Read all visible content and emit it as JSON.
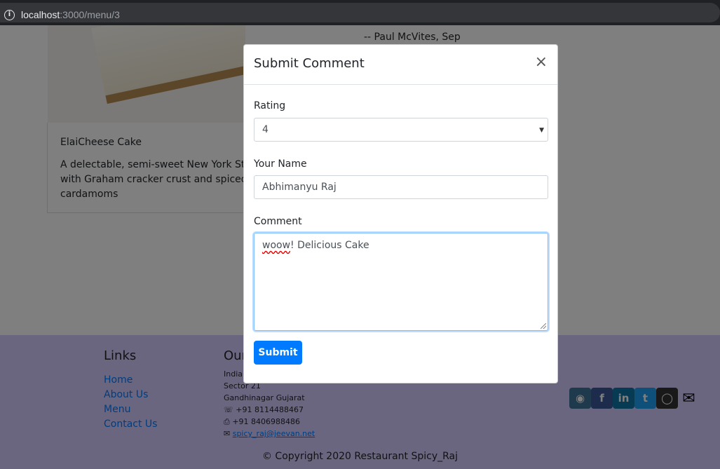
{
  "browser": {
    "url_host": "localhost",
    "url_path": ":3000/menu/3"
  },
  "dish": {
    "name": "ElaiCheese Cake",
    "description_lines": [
      "A delectable, semi-sweet New York Style C",
      "with Graham cracker crust and spiced wit",
      "cardamoms"
    ]
  },
  "comment_author": "-- Paul McVites, Sep",
  "footer": {
    "links_heading": "Links",
    "links": [
      "Home",
      "About Us",
      "Menu",
      "Contact Us"
    ],
    "address_heading": "Our",
    "address_lines": [
      "Indiar",
      "Sector 21",
      "Gandhinagar Gujarat"
    ],
    "phone": "+91 8114488467",
    "fax": "+91 8406988486",
    "email": "spicy_raj@jeevan.net",
    "copyright": "© Copyright 2020 Restaurant Spicy_Raj",
    "social_icons": [
      "instagram-icon",
      "facebook-icon",
      "linkedin-icon",
      "twitter-icon",
      "github-icon",
      "mail-icon"
    ],
    "colors": {
      "background": "#d6ccff",
      "link": "#007bff"
    }
  },
  "modal": {
    "title": "Submit Comment",
    "close_symbol": "×",
    "rating_label": "Rating",
    "rating_value": "4",
    "name_label": "Your Name",
    "name_value": "Abhimanyu Raj",
    "comment_label": "Comment",
    "comment_misspelled": "woow",
    "comment_rest": "! Delicious Cake",
    "submit_label": "Submit",
    "colors": {
      "primary": "#007bff"
    }
  }
}
